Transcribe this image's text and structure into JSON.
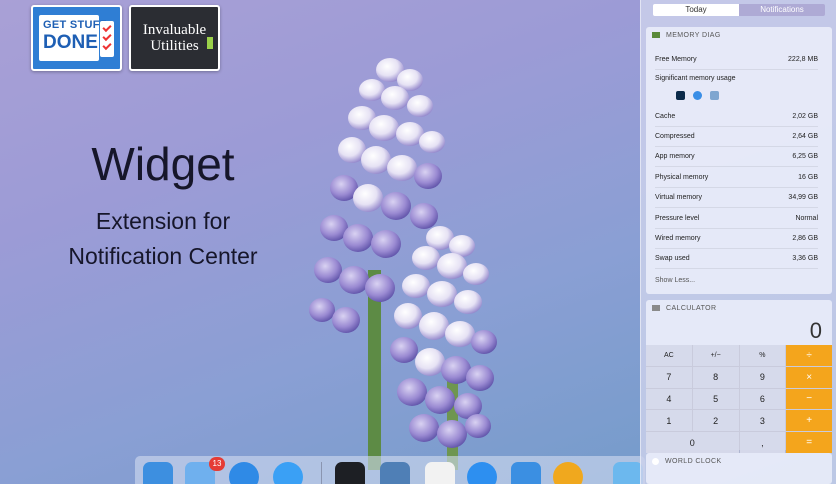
{
  "badges": {
    "gsd_line1": "GET STUFF",
    "gsd_line2": "DONE",
    "iu_line1": "Invaluable",
    "iu_line2": "Utilities"
  },
  "hero": {
    "title": "Widget",
    "subtitle1": "Extension for",
    "subtitle2": "Notification Center"
  },
  "notification_center": {
    "tabs": [
      {
        "label": "Today",
        "active": true
      },
      {
        "label": "Notifications",
        "active": false
      }
    ],
    "memory_diag": {
      "title": "MEMORY DIAG",
      "rows": [
        {
          "label": "Free Memory",
          "value": "222,8 MB"
        },
        {
          "label": "Significant memory usage",
          "value": ""
        },
        {
          "label": "Cache",
          "value": "2,02 GB"
        },
        {
          "label": "Compressed",
          "value": "2,64 GB"
        },
        {
          "label": "App memory",
          "value": "6,25 GB"
        },
        {
          "label": "Physical memory",
          "value": "16 GB"
        },
        {
          "label": "Virtual memory",
          "value": "34,99 GB"
        },
        {
          "label": "Pressure level",
          "value": "Normal"
        },
        {
          "label": "Wired memory",
          "value": "2,86 GB"
        },
        {
          "label": "Swap used",
          "value": "3,36 GB"
        }
      ],
      "show_less": "Show Less..."
    },
    "calculator": {
      "title": "CALCULATOR",
      "display": "0",
      "keys": [
        {
          "label": "AC",
          "kind": "fn"
        },
        {
          "label": "+/−",
          "kind": "fn"
        },
        {
          "label": "%",
          "kind": "fn"
        },
        {
          "label": "÷",
          "kind": "op"
        },
        {
          "label": "7",
          "kind": "num"
        },
        {
          "label": "8",
          "kind": "num"
        },
        {
          "label": "9",
          "kind": "num"
        },
        {
          "label": "×",
          "kind": "op"
        },
        {
          "label": "4",
          "kind": "num"
        },
        {
          "label": "5",
          "kind": "num"
        },
        {
          "label": "6",
          "kind": "num"
        },
        {
          "label": "−",
          "kind": "op"
        },
        {
          "label": "1",
          "kind": "num"
        },
        {
          "label": "2",
          "kind": "num"
        },
        {
          "label": "3",
          "kind": "num"
        },
        {
          "label": "+",
          "kind": "op"
        },
        {
          "label": "0",
          "kind": "zero"
        },
        {
          "label": ",",
          "kind": "num"
        },
        {
          "label": "=",
          "kind": "op"
        }
      ]
    },
    "world_clock": {
      "title": "WORLD CLOCK"
    }
  },
  "dock": {
    "mail_badge": "13",
    "icons": [
      {
        "name": "finder-icon",
        "color": "#3d8fe0"
      },
      {
        "name": "mail-icon",
        "color": "#6fb0ee"
      },
      {
        "name": "safari-icon",
        "color": "#2f8ae6"
      },
      {
        "name": "messages-icon",
        "color": "#3aa0f5"
      },
      {
        "name": "terminal-icon",
        "color": "#1d1f24"
      },
      {
        "name": "preview-icon",
        "color": "#4f7fb6"
      },
      {
        "name": "textedit-icon",
        "color": "#f2f2f2"
      },
      {
        "name": "app-store-icon",
        "color": "#2d8ff0"
      },
      {
        "name": "xcode-icon",
        "color": "#3b8fe2"
      },
      {
        "name": "quicktime-icon",
        "color": "#f0a81e"
      },
      {
        "name": "folder-icon",
        "color": "#6cb8ee"
      }
    ]
  }
}
